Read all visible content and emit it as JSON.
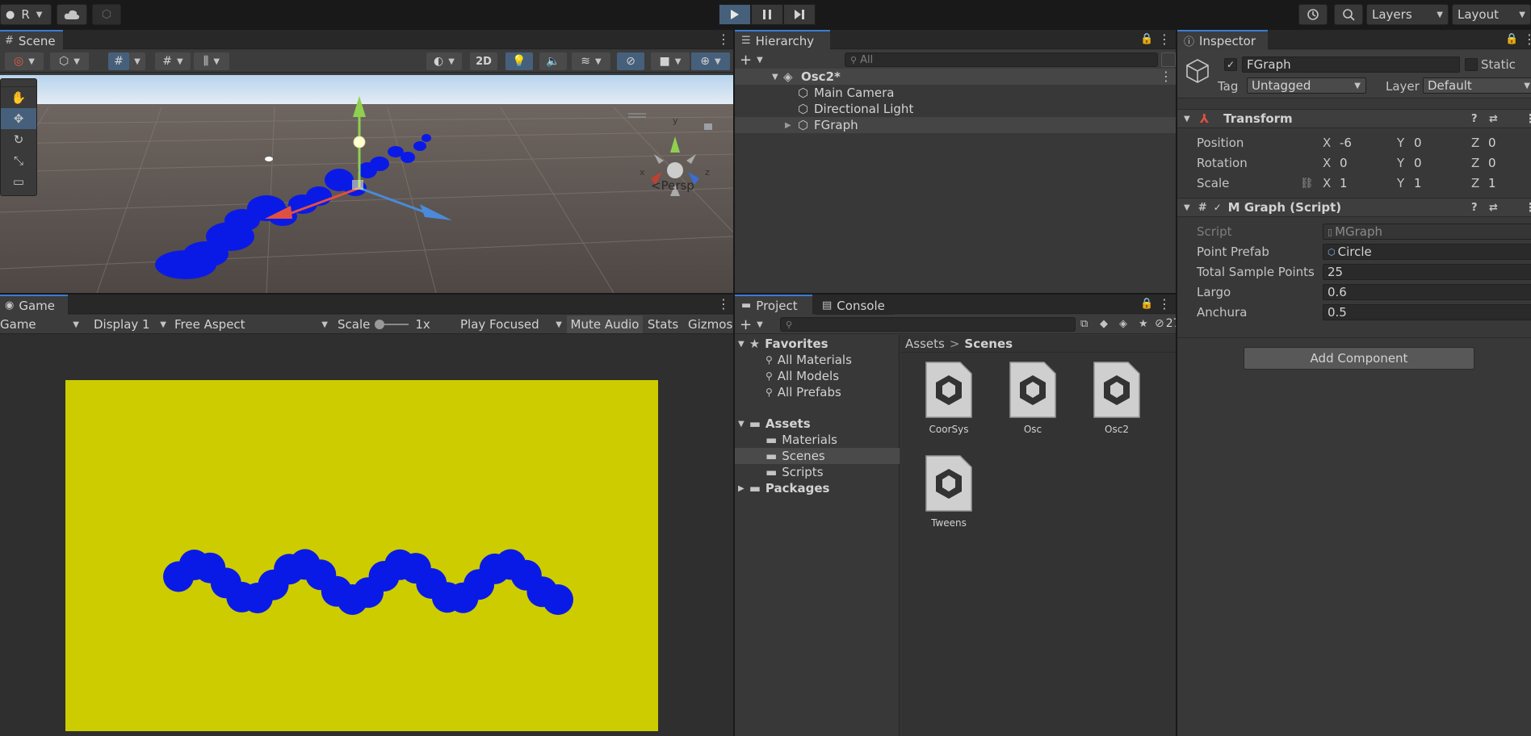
{
  "topbar": {
    "account_label": "R",
    "layers_label": "Layers",
    "layout_label": "Layout"
  },
  "scene": {
    "tab_label": "Scene",
    "toggle_2d": "2D",
    "view_label": "Persp",
    "gizmo_axes": {
      "x": "x",
      "y": "y",
      "z": "z"
    }
  },
  "game": {
    "tab_label": "Game",
    "view_dropdown": "Game",
    "display_dropdown": "Display 1",
    "aspect_dropdown": "Free Aspect",
    "scale_label": "Scale",
    "scale_value": "1x",
    "play_mode_dropdown": "Play Focused",
    "mute_audio": "Mute Audio",
    "stats": "Stats",
    "gizmos": "Gizmos",
    "background_color": "#cccc00",
    "circle_color": "#0a1ae6"
  },
  "hierarchy": {
    "tab_label": "Hierarchy",
    "search_placeholder": "All",
    "scene_name": "Osc2*",
    "items": [
      "Main Camera",
      "Directional Light",
      "FGraph"
    ]
  },
  "project": {
    "tab_label": "Project",
    "console_tab_label": "Console",
    "hidden_count": "27",
    "favorites_label": "Favorites",
    "favorites": [
      "All Materials",
      "All Models",
      "All Prefabs"
    ],
    "assets_label": "Assets",
    "asset_folders": [
      "Materials",
      "Scenes",
      "Scripts"
    ],
    "packages_label": "Packages",
    "breadcrumb": [
      "Assets",
      "Scenes"
    ],
    "breadcrumb_sep": ">",
    "files": [
      "CoorSys",
      "Osc",
      "Osc2",
      "Tweens"
    ]
  },
  "inspector": {
    "tab_label": "Inspector",
    "object_name": "FGraph",
    "static_label": "Static",
    "tag_label": "Tag",
    "tag_value": "Untagged",
    "layer_label": "Layer",
    "layer_value": "Default",
    "transform": {
      "title": "Transform",
      "position_label": "Position",
      "rotation_label": "Rotation",
      "scale_label": "Scale",
      "axis_x": "X",
      "axis_y": "Y",
      "axis_z": "Z",
      "position": [
        "-6",
        "0",
        "0"
      ],
      "rotation": [
        "0",
        "0",
        "0"
      ],
      "scale": [
        "1",
        "1",
        "1"
      ]
    },
    "script_component": {
      "title": "M Graph (Script)",
      "script_label": "Script",
      "script_value": "MGraph",
      "point_prefab_label": "Point Prefab",
      "point_prefab_value": "Circle",
      "total_sample_points_label": "Total Sample Points",
      "total_sample_points_value": "25",
      "largo_label": "Largo",
      "largo_value": "0.6",
      "anchura_label": "Anchura",
      "anchura_value": "0.5"
    },
    "add_component": "Add Component"
  }
}
